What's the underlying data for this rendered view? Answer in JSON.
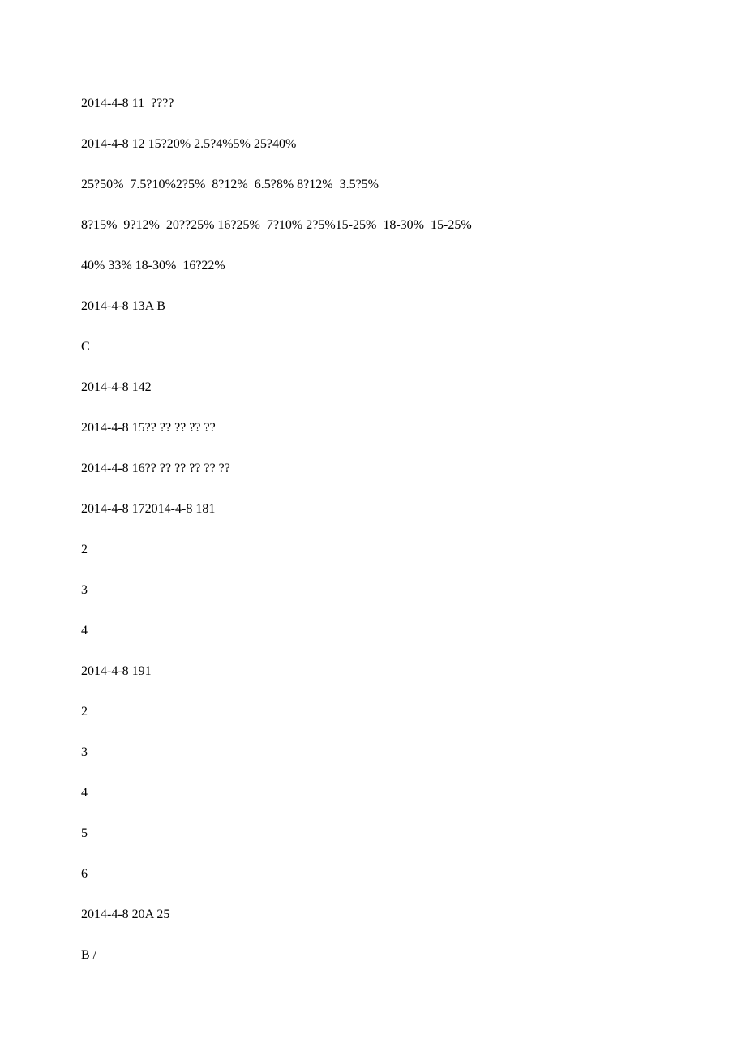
{
  "lines": [
    "2014-4-8 11  ????",
    "2014-4-8 12 15?20% 2.5?4%5% 25?40%",
    "25?50%  7.5?10%2?5%  8?12%  6.5?8% 8?12%  3.5?5%",
    "8?15%  9?12%  20??25% 16?25%  7?10% 2?5%15-25%  18-30%  15-25%",
    "40% 33% 18-30%  16?22%",
    "2014-4-8 13A B",
    "C",
    "2014-4-8 142",
    "2014-4-8 15?? ?? ?? ?? ??",
    "2014-4-8 16?? ?? ?? ?? ?? ??",
    "2014-4-8 172014-4-8 181",
    "2",
    "3",
    "4",
    "2014-4-8 191",
    "2",
    "3",
    "4",
    "5",
    "6",
    "2014-4-8 20A 25",
    "B /"
  ]
}
